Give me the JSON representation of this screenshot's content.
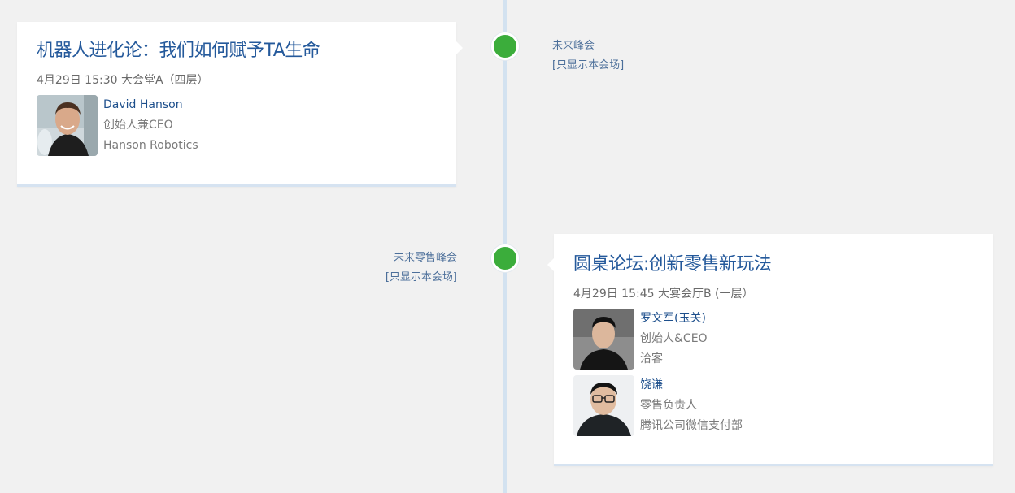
{
  "sessions": [
    {
      "title": "机器人进化论：我们如何赋予TA生命",
      "time": "4月29日 15:30",
      "room": "大会堂A（四层）",
      "venue": "未来峰会",
      "filter_label": "[只显示本会场]",
      "speakers": [
        {
          "name": "David Hanson",
          "role": "创始人兼CEO",
          "org": "Hanson Robotics"
        }
      ]
    },
    {
      "title": "圆桌论坛:创新零售新玩法",
      "time": "4月29日 15:45",
      "room": "大宴会厅B (一层）",
      "venue": "未来零售峰会",
      "filter_label": "[只显示本会场]",
      "speakers": [
        {
          "name": "罗文军(玉关)",
          "role": "创始人&CEO",
          "org": "洽客"
        },
        {
          "name": "饶谦",
          "role": "零售负责人",
          "org": "腾讯公司微信支付部"
        }
      ]
    }
  ],
  "colors": {
    "background": "#f1f1f1",
    "axis": "#d3e2f0",
    "dot": "#3bad3b",
    "title": "#24599b",
    "speaker_name": "#1d4f8c"
  }
}
